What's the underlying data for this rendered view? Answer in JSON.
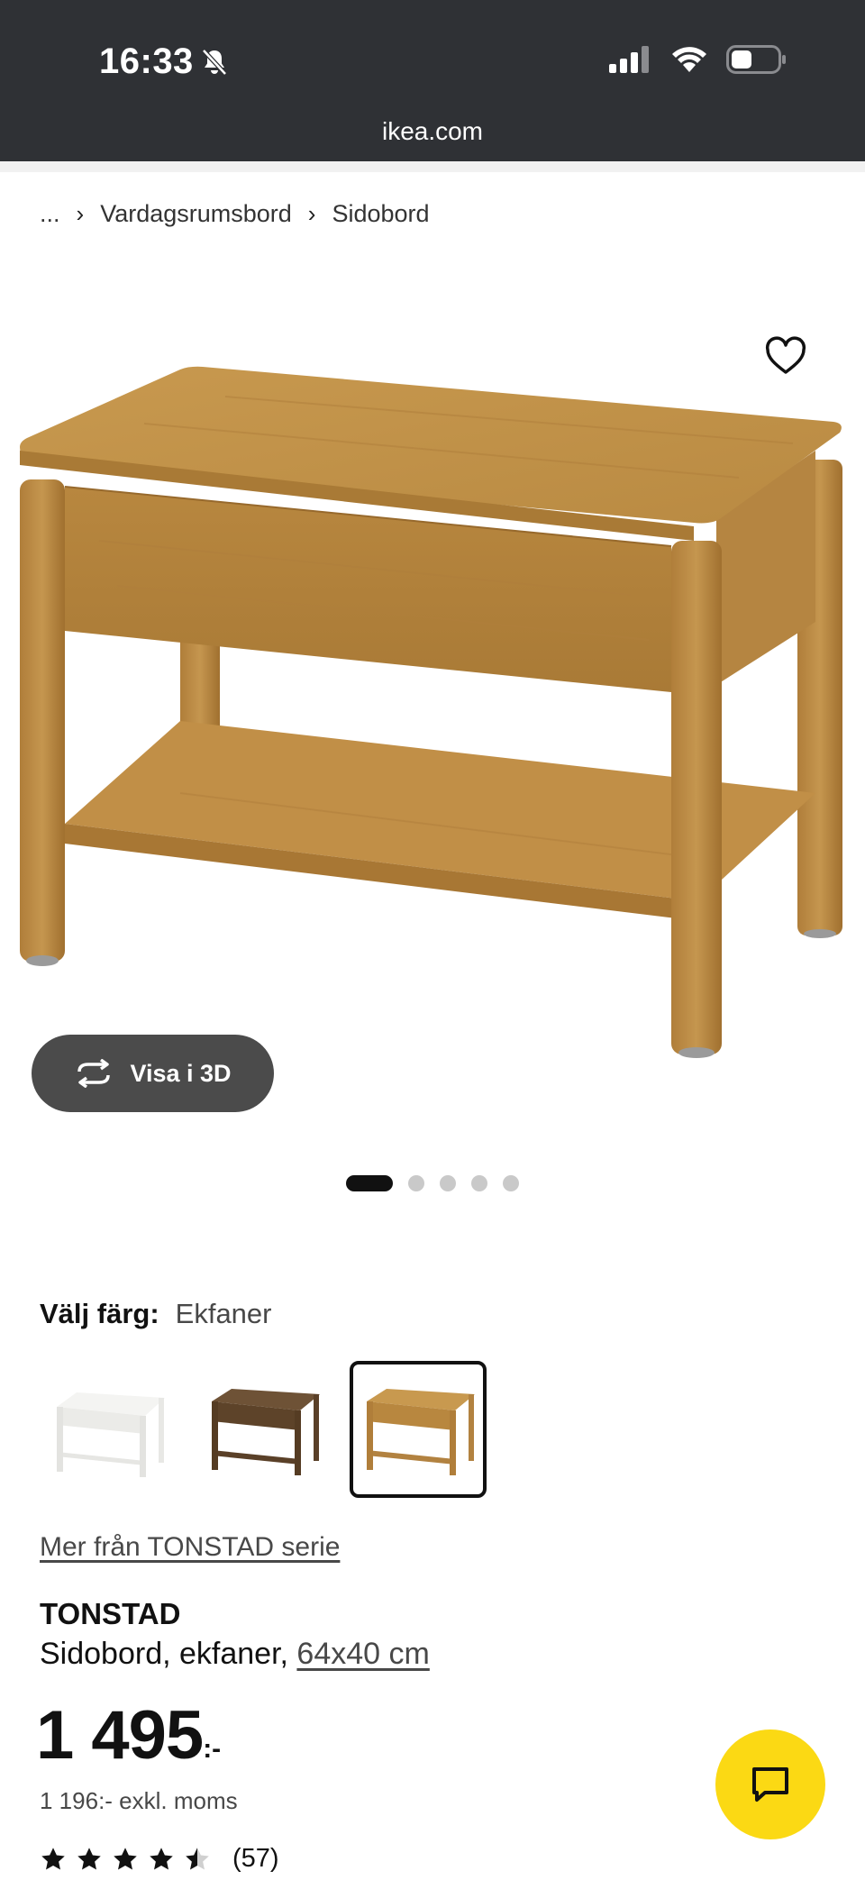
{
  "status_bar": {
    "time": "16:33",
    "mute_icon": "bell-slash-icon",
    "signal_icon": "cellular-signal-icon",
    "wifi_icon": "wifi-icon",
    "battery_icon": "battery-icon"
  },
  "browser": {
    "url": "ikea.com"
  },
  "breadcrumb": {
    "ellipsis": "...",
    "items": [
      "Vardagsrumsbord",
      "Sidobord"
    ]
  },
  "gallery": {
    "view_3d_label": "Visa i 3D",
    "image_count": 5,
    "active_index": 0
  },
  "color": {
    "label": "Välj färg:",
    "value": "Ekfaner",
    "options": [
      "white",
      "dark-brown",
      "oak"
    ],
    "selected_index": 2
  },
  "series_link": "Mer från TONSTAD serie",
  "product": {
    "name": "TONSTAD",
    "description": "Sidobord, ekfaner, ",
    "dimensions": "64x40 cm"
  },
  "price": {
    "main": "1 495",
    "suffix": ":-",
    "excl_vat": "1 196:- exkl. moms"
  },
  "rating": {
    "stars": 4.5,
    "count": "(57)"
  },
  "colors": {
    "topbar": "#2f3135",
    "chat_button": "#fbd914",
    "view3d_button": "#4b4b4b"
  }
}
